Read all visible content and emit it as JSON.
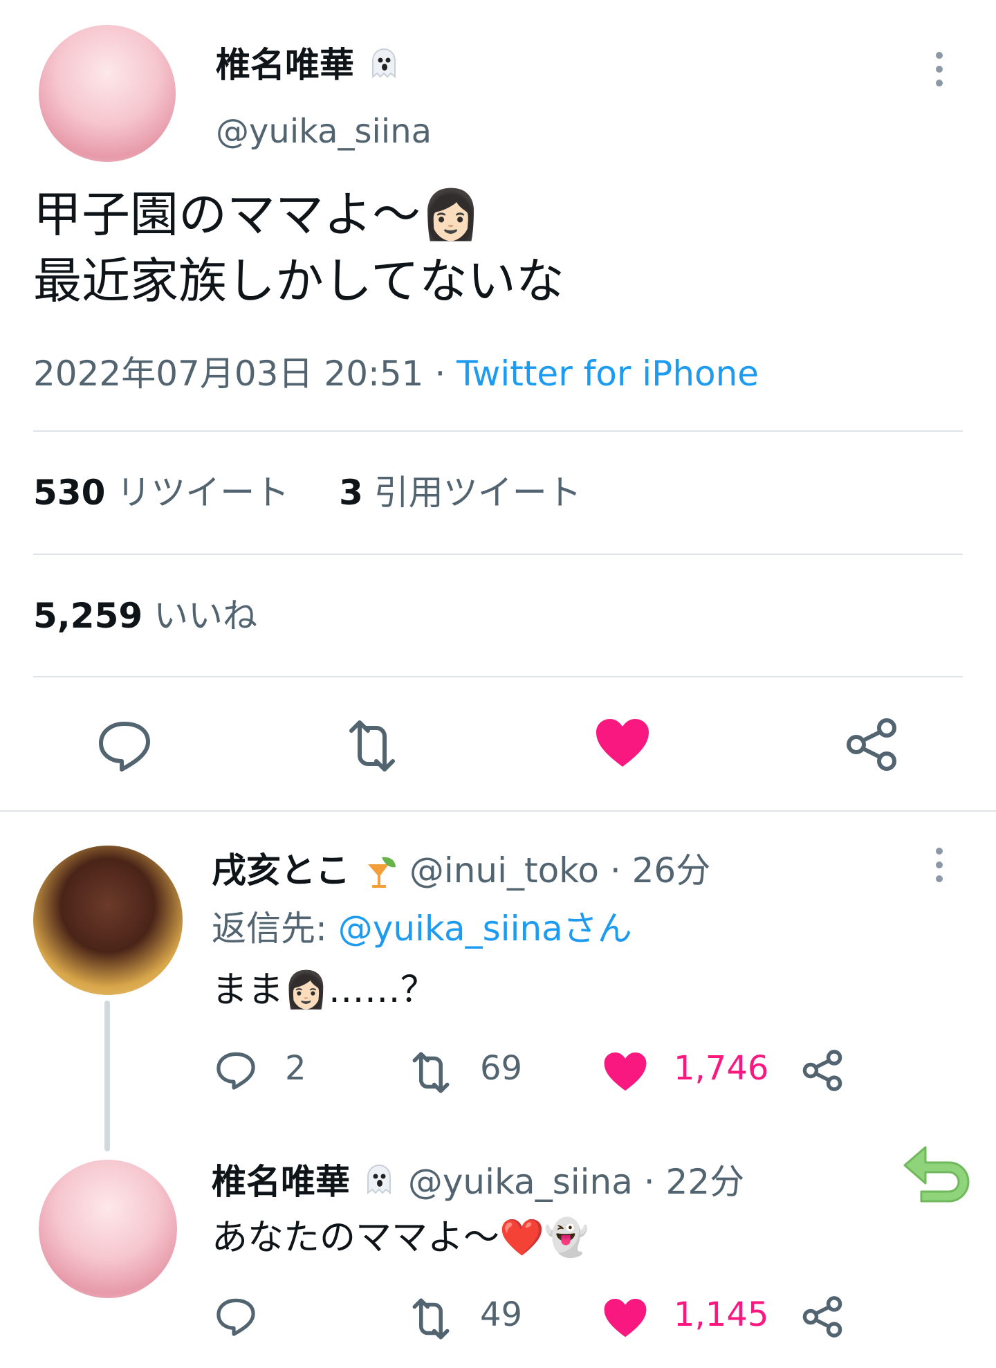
{
  "main_tweet": {
    "display_name": "椎名唯華",
    "name_emoji": "ghost-emoji",
    "handle": "@yuika_siina",
    "text_line1": "甲子園のママよ〜👩🏻",
    "text_line2": "最近家族しかしてないな",
    "timestamp": "2022年07月03日 20:51 · ",
    "source": "Twitter for iPhone",
    "retweets_count": "530",
    "retweets_label": "リツイート",
    "quotes_count": "3",
    "quotes_label": "引用ツイート",
    "likes_count": "5,259",
    "likes_label": "いいね"
  },
  "reply1": {
    "display_name": "戌亥とこ",
    "name_emoji": "cocktail-emoji",
    "handle_time": "@inui_toko · 26分",
    "reply_to_prefix": "返信先: ",
    "reply_to_handle": "@yuika_siinaさん",
    "text": "まま👩🏻……？",
    "replies": "2",
    "retweets": "69",
    "likes": "1,746"
  },
  "reply2": {
    "display_name": "椎名唯華",
    "name_emoji": "ghost-emoji",
    "handle_time": "@yuika_siina · 22分",
    "text": "あなたのママよ〜❤️👻",
    "retweets": "49",
    "likes": "1,145"
  },
  "colors": {
    "like": "#f91880",
    "link": "#1d9bf0",
    "secondary": "#536471",
    "back_arrow": "#8fd37a"
  }
}
